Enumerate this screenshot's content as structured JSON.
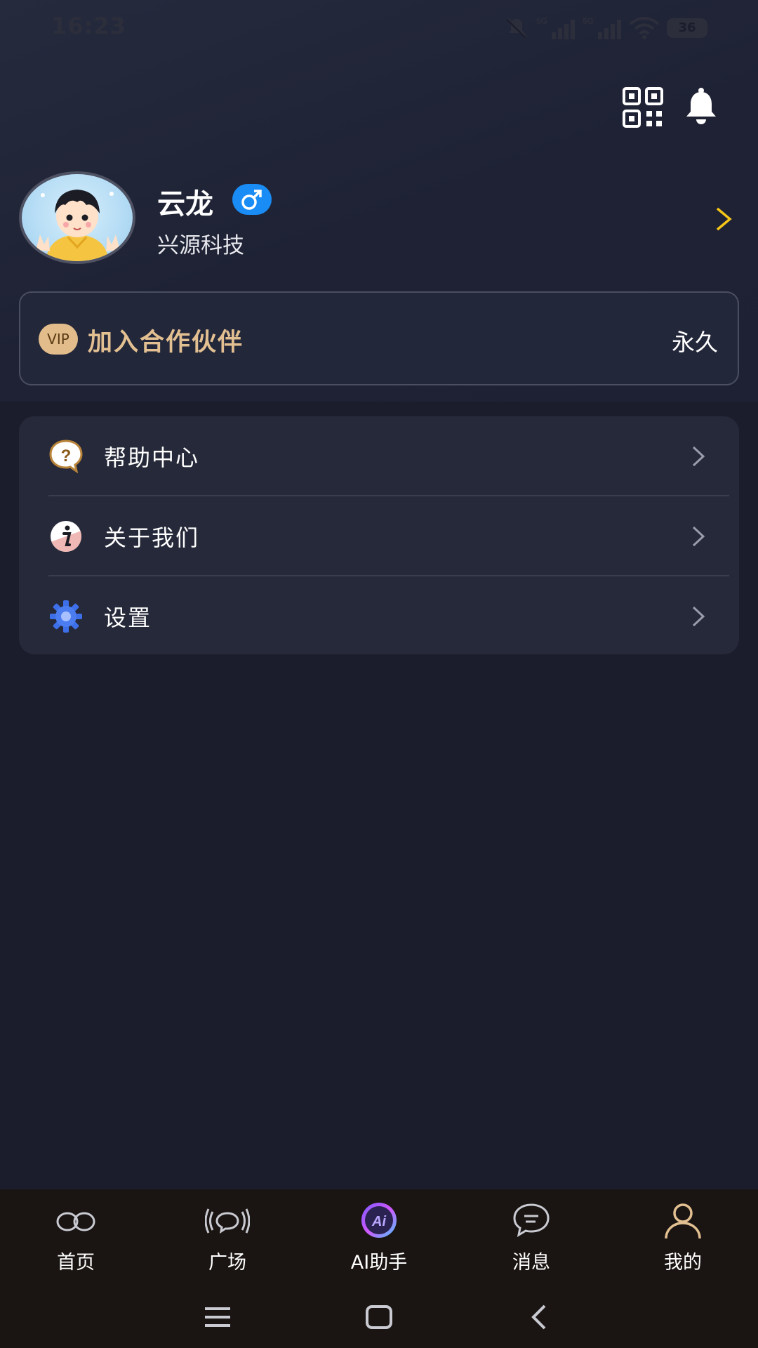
{
  "status_bar": {
    "time": "16:23",
    "battery": "36",
    "network_1": "5G",
    "network_2": "5G"
  },
  "top_actions": {
    "qr": "qr-code-icon",
    "bell": "bell-icon"
  },
  "profile": {
    "name": "云龙",
    "gender": "♂",
    "company": "兴源科技"
  },
  "vip": {
    "badge": "VIP",
    "title": "加入合作伙伴",
    "status": "永久"
  },
  "menu": {
    "items": [
      {
        "label": "帮助中心",
        "icon": "help-icon"
      },
      {
        "label": "关于我们",
        "icon": "info-icon"
      },
      {
        "label": "设置",
        "icon": "settings-gear-icon"
      }
    ]
  },
  "bottom_nav": {
    "items": [
      {
        "label": "首页",
        "icon": "home-icon"
      },
      {
        "label": "广场",
        "icon": "square-broadcast-icon"
      },
      {
        "label": "AI助手",
        "icon": "ai-assistant-icon",
        "badge": "Ai"
      },
      {
        "label": "消息",
        "icon": "message-icon"
      },
      {
        "label": "我的",
        "icon": "user-profile-icon"
      }
    ],
    "active": "我的"
  },
  "colors": {
    "accent_gold": "#e3c091",
    "chevron_yellow": "#f5c518",
    "gender_blue": "#1a8cf5",
    "background": "#1c1d2c"
  }
}
